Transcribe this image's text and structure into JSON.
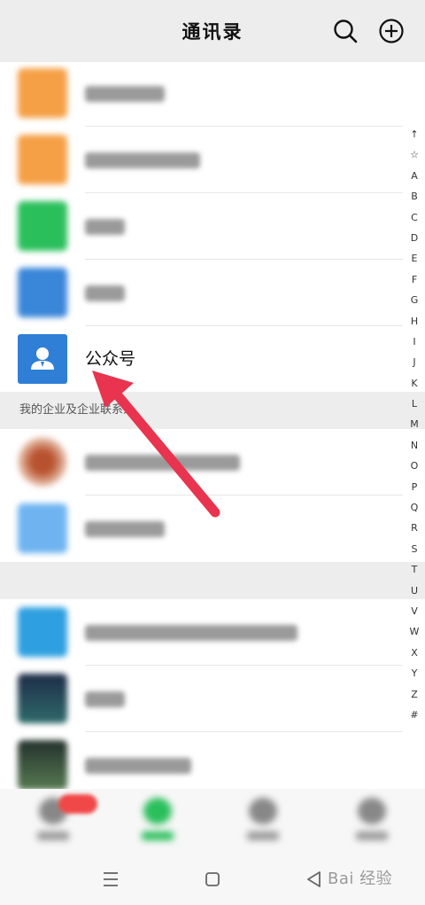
{
  "header": {
    "title": "通讯录",
    "search_icon": "search-icon",
    "add_icon": "plus-circle-icon"
  },
  "main": {
    "public_accounts_label": "公众号",
    "section_enterprise": "我的企业及企业联系人"
  },
  "index_letters": [
    "↑",
    "☆",
    "A",
    "B",
    "C",
    "D",
    "E",
    "F",
    "G",
    "H",
    "I",
    "J",
    "K",
    "L",
    "M",
    "N",
    "O",
    "P",
    "Q",
    "R",
    "S",
    "T",
    "U",
    "V",
    "W",
    "X",
    "Y",
    "Z",
    "#"
  ],
  "watermark": "Bai 经验",
  "colors": {
    "orange": "#f5a046",
    "green": "#2bbf5c",
    "blue": "#3a86d8",
    "accent": "#e8344e",
    "bg": "#ededed"
  }
}
